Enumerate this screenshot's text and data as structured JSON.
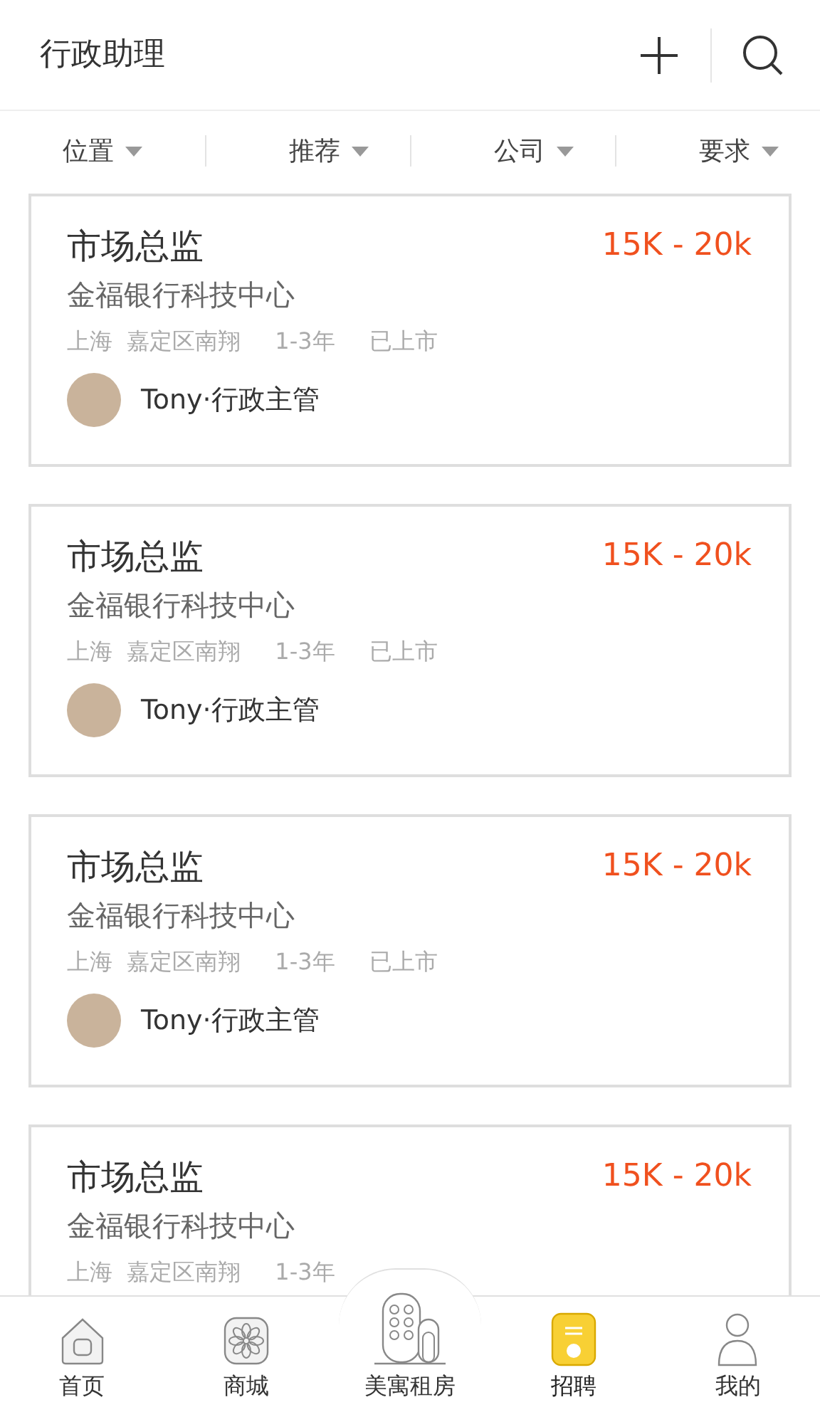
{
  "header": {
    "title": "行政助理"
  },
  "filters": [
    {
      "label": "位置"
    },
    {
      "label": "推荐"
    },
    {
      "label": "公司"
    },
    {
      "label": "要求"
    }
  ],
  "jobs": [
    {
      "title": "市场总监",
      "salary": "15K - 20k",
      "company": "金福银行科技中心",
      "meta": [
        "上海  嘉定区南翔",
        "1-3年",
        "已上市"
      ],
      "recruiter": "Tony·行政主管"
    },
    {
      "title": "市场总监",
      "salary": "15K - 20k",
      "company": "金福银行科技中心",
      "meta": [
        "上海  嘉定区南翔",
        "1-3年",
        "已上市"
      ],
      "recruiter": "Tony·行政主管"
    },
    {
      "title": "市场总监",
      "salary": "15K - 20k",
      "company": "金福银行科技中心",
      "meta": [
        "上海  嘉定区南翔",
        "1-3年",
        "已上市"
      ],
      "recruiter": "Tony·行政主管"
    },
    {
      "title": "市场总监",
      "salary": "15K - 20k",
      "company": "金福银行科技中心",
      "meta": [
        "上海  嘉定区南翔",
        "1-3年"
      ]
    }
  ],
  "tab_bar": [
    {
      "label": "首页",
      "kind": "home",
      "selected": false
    },
    {
      "label": "商城",
      "kind": "mall",
      "selected": false
    },
    {
      "label": "美寓租房",
      "kind": "rent",
      "selected": false
    },
    {
      "label": "招聘",
      "kind": "jobs",
      "selected": true
    },
    {
      "label": "我的",
      "kind": "me",
      "selected": false
    }
  ]
}
